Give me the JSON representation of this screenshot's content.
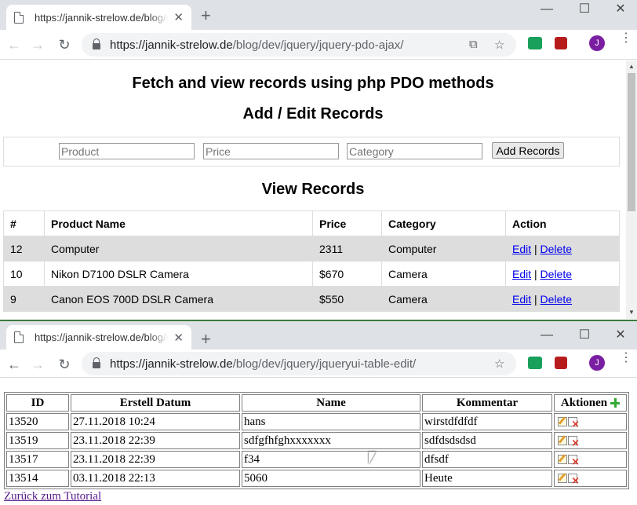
{
  "window1": {
    "tab_title": "https://jannik-strelow.de/blog/de",
    "url_host": "https://jannik-strelow.de",
    "url_path": "/blog/dev/jquery/jquery-pdo-ajax/",
    "avatar_letter": "J",
    "page": {
      "title": "Fetch and view records using php PDO methods",
      "subtitle": "Add / Edit Records",
      "form": {
        "product_placeholder": "Product",
        "price_placeholder": "Price",
        "category_placeholder": "Category",
        "add_button": "Add Records"
      },
      "view_title": "View Records",
      "table": {
        "headers": [
          "#",
          "Product Name",
          "Price",
          "Category",
          "Action"
        ],
        "rows": [
          {
            "id": "12",
            "name": "Computer",
            "price": "2311",
            "category": "Computer"
          },
          {
            "id": "10",
            "name": "Nikon D7100 DSLR Camera",
            "price": "$670",
            "category": "Camera"
          },
          {
            "id": "9",
            "name": "Canon EOS 700D DSLR Camera",
            "price": "$550",
            "category": "Camera"
          }
        ],
        "edit_label": "Edit",
        "separator": "|",
        "delete_label": "Delete"
      }
    }
  },
  "window2": {
    "tab_title": "https://jannik-strelow.de/blog/de",
    "url_host": "https://jannik-strelow.de",
    "url_path": "/blog/dev/jquery/jqueryui-table-edit/",
    "avatar_letter": "J",
    "page": {
      "table": {
        "headers": [
          "ID",
          "Erstell Datum",
          "Name",
          "Kommentar",
          "Aktionen"
        ],
        "rows": [
          {
            "id": "13520",
            "date": "27.11.2018 10:24",
            "name": "hans",
            "comment": "wirstdfdfdf"
          },
          {
            "id": "13519",
            "date": "23.11.2018 22:39",
            "name": "sdfgfhfghxxxxxxx",
            "comment": "sdfdsdsdsd"
          },
          {
            "id": "13517",
            "date": "23.11.2018 22:39",
            "name": "f34",
            "comment": "dfsdf"
          },
          {
            "id": "13514",
            "date": "03.11.2018 22:13",
            "name": "5060",
            "comment": "Heute"
          }
        ]
      },
      "back_link": "Zurück zum Tutorial"
    }
  },
  "colors": {
    "accent_link": "#0000ee",
    "visited_link": "#551a8b",
    "row_stripe": "#dddddd",
    "avatar": "#7b1fa2"
  }
}
